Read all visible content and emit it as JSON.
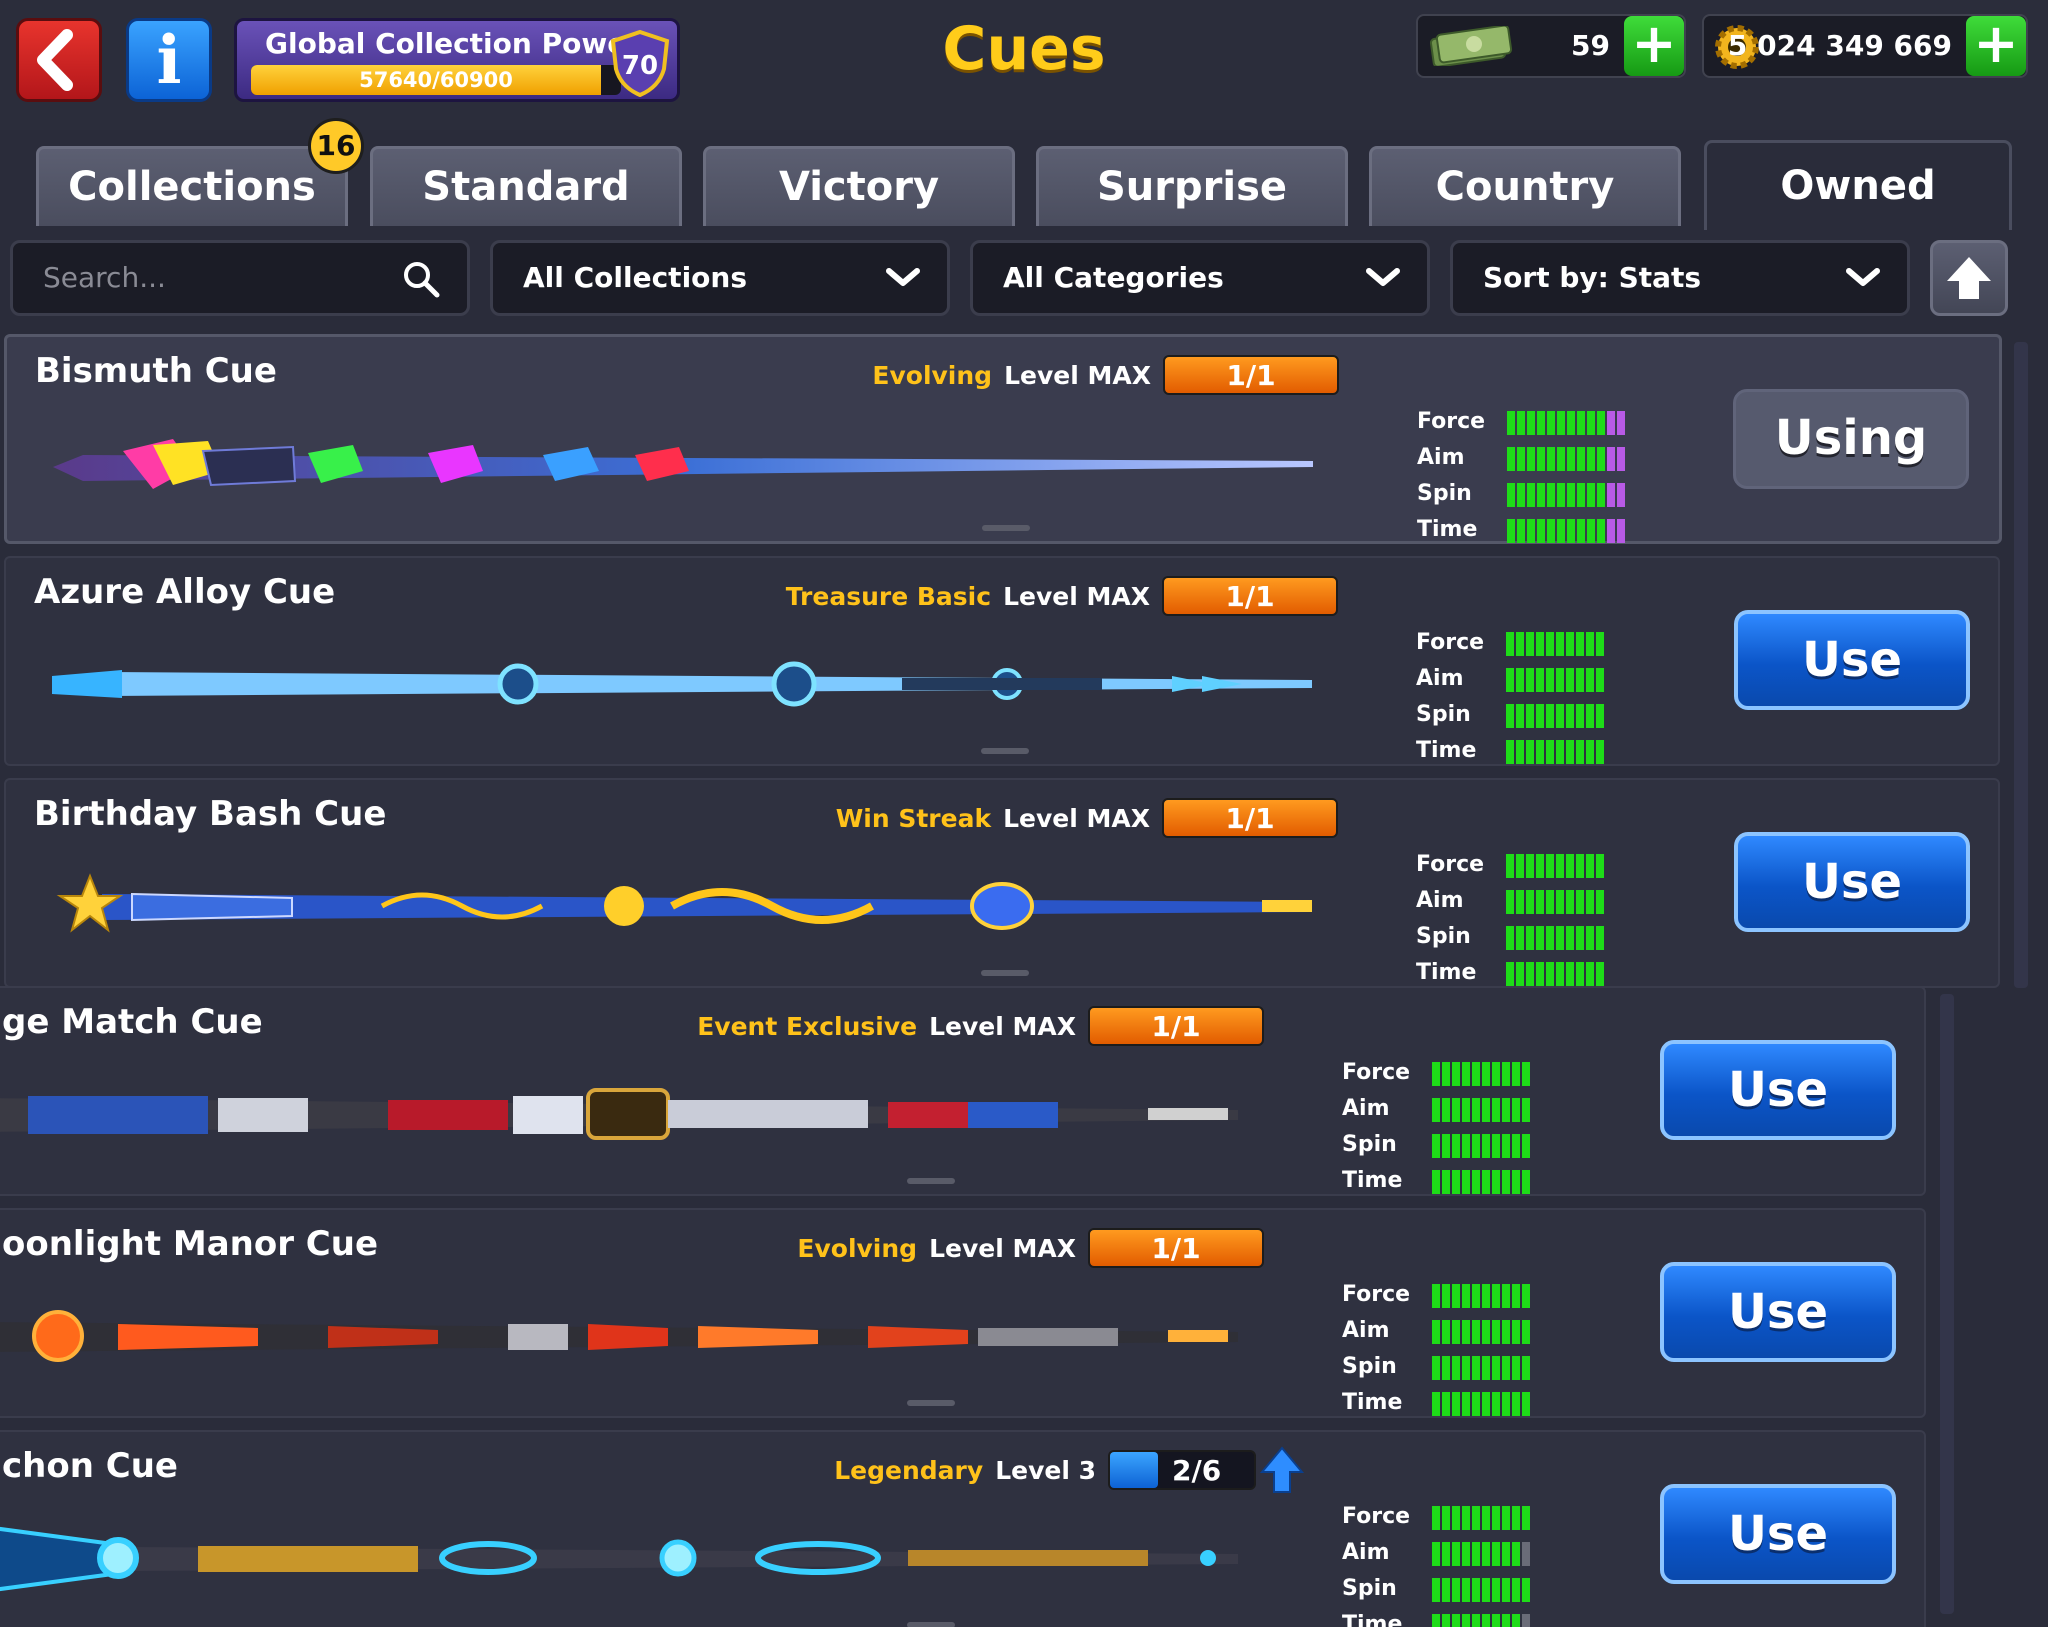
{
  "header": {
    "title": "Cues",
    "collection_power": {
      "label": "Global Collection Power",
      "progress_text": "57640/60900",
      "progress_fraction": 0.946,
      "level": "70"
    },
    "collections_badge": "16",
    "cash": {
      "value": "59"
    },
    "coins": {
      "value": "5 024 349 669"
    },
    "plus_label": "+"
  },
  "tabs": [
    {
      "label": "Collections",
      "active": false
    },
    {
      "label": "Standard",
      "active": false
    },
    {
      "label": "Victory",
      "active": false
    },
    {
      "label": "Surprise",
      "active": false
    },
    {
      "label": "Country",
      "active": false
    },
    {
      "label": "Owned",
      "active": true
    }
  ],
  "filters": {
    "search_placeholder": "Search...",
    "collections": "All Collections",
    "categories": "All Categories",
    "sort": "Sort by: Stats"
  },
  "stat_labels": [
    "Force",
    "Aim",
    "Spin",
    "Time"
  ],
  "cues": [
    {
      "name": "Bismuth Cue",
      "category": "Evolving",
      "level": "Level MAX",
      "progress": "1/1",
      "progress_style": "orange",
      "stats": [
        [
          10,
          2
        ],
        [
          10,
          2
        ],
        [
          10,
          2
        ],
        [
          10,
          2
        ]
      ],
      "action": "Using"
    },
    {
      "name": "Azure Alloy Cue",
      "category": "Treasure Basic",
      "level": "Level MAX",
      "progress": "1/1",
      "progress_style": "orange",
      "stats": [
        [
          10,
          0
        ],
        [
          10,
          0
        ],
        [
          10,
          0
        ],
        [
          10,
          0
        ]
      ],
      "action": "Use"
    },
    {
      "name": "Birthday Bash Cue",
      "category": "Win Streak",
      "level": "Level MAX",
      "progress": "1/1",
      "progress_style": "orange",
      "stats": [
        [
          10,
          0
        ],
        [
          10,
          0
        ],
        [
          10,
          0
        ],
        [
          10,
          0
        ]
      ],
      "action": "Use"
    },
    {
      "name": "ge Match Cue",
      "category": "Event Exclusive",
      "level": "Level MAX",
      "progress": "1/1",
      "progress_style": "orange",
      "stats": [
        [
          10,
          0
        ],
        [
          10,
          0
        ],
        [
          10,
          0
        ],
        [
          10,
          0
        ]
      ],
      "action": "Use"
    },
    {
      "name": "oonlight Manor Cue",
      "category": "Evolving",
      "level": "Level MAX",
      "progress": "1/1",
      "progress_style": "orange",
      "stats": [
        [
          10,
          0
        ],
        [
          10,
          0
        ],
        [
          10,
          0
        ],
        [
          10,
          0
        ]
      ],
      "action": "Use"
    },
    {
      "name": "chon Cue",
      "category": "Legendary",
      "level": "Level 3",
      "progress": "2/6",
      "progress_style": "blue",
      "progress_fraction": 0.333,
      "stats": [
        [
          10,
          0
        ],
        [
          9,
          0
        ],
        [
          10,
          0
        ],
        [
          9,
          0
        ]
      ],
      "action": "Use"
    }
  ],
  "colors": {
    "accent_gold": "#ffcc1a",
    "stat_green": "#1edc18",
    "stat_purple": "#b85ae6",
    "use_blue": "#0b55c8",
    "progress_orange": "#ff9a1f"
  }
}
